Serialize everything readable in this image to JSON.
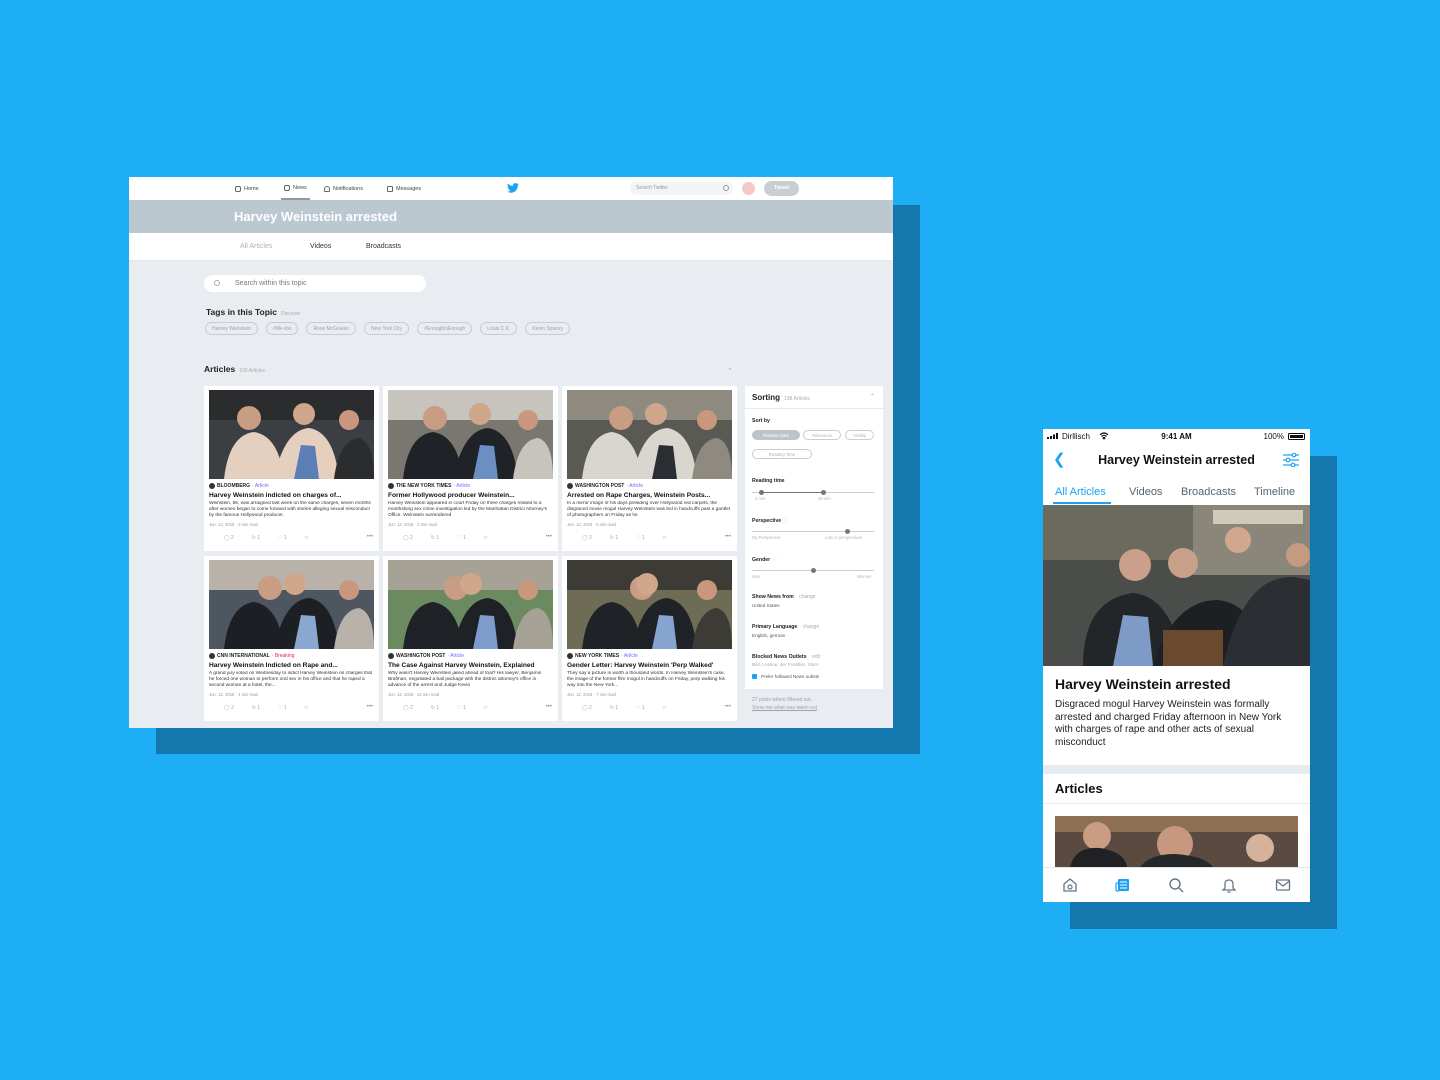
{
  "desktop": {
    "nav": {
      "items": [
        {
          "label": "Home",
          "icon": "home-icon"
        },
        {
          "label": "News",
          "icon": "news-icon",
          "active": true
        },
        {
          "label": "Notifications",
          "icon": "bell-icon"
        },
        {
          "label": "Messages",
          "icon": "envelope-icon"
        }
      ],
      "search_placeholder": "Search Twitter",
      "tweet_label": "Tweet"
    },
    "banner_title": "Harvey Weinstein arrested",
    "subtabs": [
      "All Articles",
      "Videos",
      "Broadcasts"
    ],
    "topic_search_placeholder": "Search within this topic",
    "tags": {
      "title": "Tags in this Topic",
      "subtitle": "Discover",
      "items": [
        "Harvey Weinstein",
        "#Me-too",
        "Rose McGowan",
        "New York City",
        "#EnoughIsEnough",
        "Louis C.K.",
        "Kevin Spacey"
      ]
    },
    "articles": {
      "title": "Articles",
      "count": "100 Articles",
      "cards": [
        {
          "source": "BLOOMBERG",
          "type": "Article",
          "title": "Harvey Weinstein indicted on charges of...",
          "excerpt": "Weinstein, 66, was arraigned last week on the same charges, seven months after women began to come forward with stories alleging sexual misconduct by the famous Hollywood producer.",
          "meta": "Jun. 12, 2018 · 3 min read",
          "replies": "2",
          "retweets": "1",
          "likes": "1"
        },
        {
          "source": "THE NEW YORK TIMES",
          "type": "Article",
          "title": "Former Hollywood producer Weinstein...",
          "excerpt": "Harvey Weinstein appeared in court Friday on three charges related to a monthslong sex crime investigation led by the Manhattan District Attorney's Office. Weinstein surrendered",
          "meta": "Jun. 12, 2018 · 2 min read",
          "replies": "2",
          "retweets": "1",
          "likes": "1"
        },
        {
          "source": "WASHINGTON POST",
          "type": "Article",
          "title": "Arrested on Rape Charges, Weinstein Posts...",
          "excerpt": "In a mirror image of his days presiding over Hollywood red carpets, the disgraced movie mogul Harvey Weinstein was led in handcuffs past a gantlet of photographers on Friday as he",
          "meta": "Jun. 12, 2018 · 6 min read",
          "replies": "2",
          "retweets": "1",
          "likes": "1"
        },
        {
          "source": "CNN INTERNATIONAL",
          "type": "Breaking",
          "title": "Harvey Weinstein Indicted on Rape and...",
          "excerpt": "A grand jury voted on Wednesday to indict Harvey Weinstein on charges that he forced one woman to perform oral sex in his office and that he raped a second woman at a hotel, the...",
          "meta": "Jun. 12, 2018 · 4 min read",
          "replies": "2",
          "retweets": "1",
          "likes": "1"
        },
        {
          "source": "WASHINGTON POST",
          "type": "Article",
          "title": "The Case Against Harvey Weinstein, Explained",
          "excerpt": "Why wasn't Harvey Weinstein jailed ahead of trial? His lawyer, Benjamin Brafman, negotiated a bail package with the district attorney's office in advance of the arrest and Judge Kevin",
          "meta": "Jun. 12, 2018 · 12 min read",
          "replies": "2",
          "retweets": "1",
          "likes": "1"
        },
        {
          "source": "NEW YORK TIMES",
          "type": "Article",
          "title": "Gender Letter: Harvey Weinstein 'Perp Walked'",
          "excerpt": "They say a picture is worth a thousand words. In Harvey Weinstein's case, the image of the former film mogul in handcuffs on Friday, perp walking his way into the New York...",
          "meta": "Jun. 12, 2018 · 7 min read",
          "replies": "2",
          "retweets": "1",
          "likes": "1"
        }
      ]
    },
    "sorting": {
      "title": "Sorting",
      "subtitle": "138 Articles",
      "sort_by_label": "Sort by",
      "sort_options": [
        "Release Date",
        "Relevance",
        "Virality",
        "Reading Time"
      ],
      "reading_time_label": "Reading time",
      "reading_time_min": "2 min",
      "reading_time_max": "25 min",
      "perspective_label": "Perspective",
      "perspective_left": "My Perspective",
      "perspective_right": "Lots of perspectives",
      "perspective_level": 0.78,
      "gender_label": "Gender",
      "gender_left": "Men",
      "gender_right": "Women",
      "gender_level": 0.5,
      "show_news_label": "Show News from",
      "show_news_action": "change",
      "show_news_value": "United States",
      "language_label": "Primary Language",
      "language_action": "change",
      "language_value": "English, german",
      "blocked_label": "Blocked News Outlets",
      "blocked_action": "edit",
      "blocked_value": "Bild, t-online, der Postillon, Stern",
      "prefer_label": "Prefer followed News outlets"
    },
    "filter_note": "27 posts where filtered out.",
    "filter_link": "Show me what was taken out"
  },
  "phone": {
    "status": {
      "carrier": "Dirllisch",
      "time": "9:41 AM",
      "battery": "100%"
    },
    "title": "Harvey Weinstein arrested",
    "tabs": [
      "All Articles",
      "Videos",
      "Broadcasts",
      "Timeline"
    ],
    "hero_title": "Harvey Weinstein arrested",
    "hero_desc": "Disgraced mogul Harvey Weinstein was formally arrested and charged Friday afternoon in New York with charges of rape and other acts of sexual misconduct",
    "articles_title": "Articles",
    "bottom_icons": [
      "home-icon",
      "news-icon",
      "search-icon",
      "bell-icon",
      "envelope-icon"
    ]
  },
  "colors": {
    "background": "#1daef5",
    "shadow": "#1478ae",
    "twitter_blue": "#1da1f2",
    "banner": "#bcc8d0"
  }
}
